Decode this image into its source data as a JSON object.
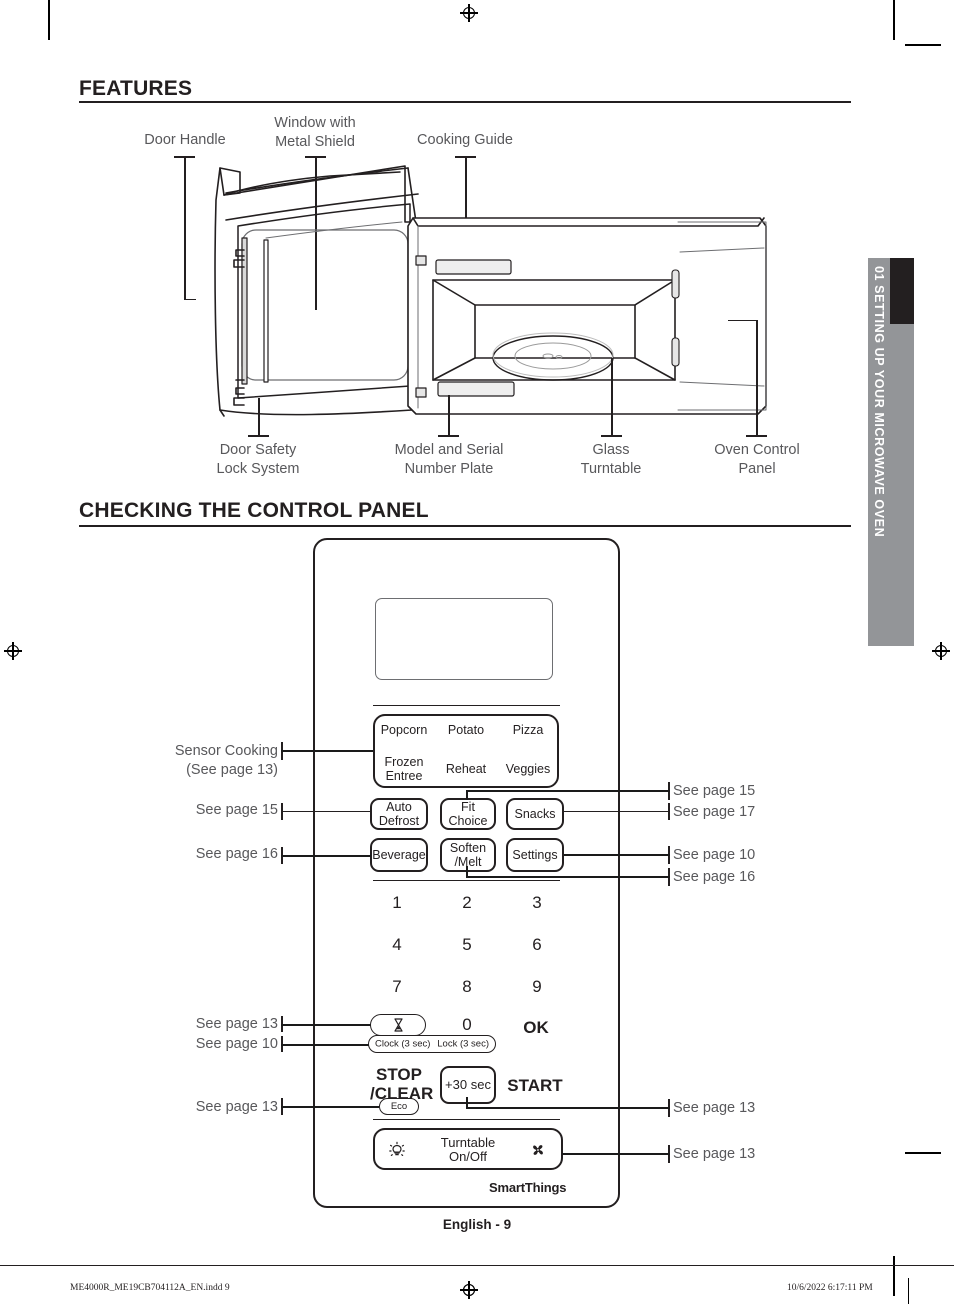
{
  "chapter_tab": {
    "label": "01  SETTING UP YOUR MICROWAVE OVEN"
  },
  "sections": {
    "features": {
      "heading": "FEATURES"
    },
    "control_panel": {
      "heading": "CHECKING THE CONTROL PANEL"
    }
  },
  "diagram": {
    "callouts_top": [
      {
        "id": "door-handle",
        "text": "Door Handle"
      },
      {
        "id": "window-metal-shield",
        "text": "Window with\nMetal Shield"
      },
      {
        "id": "cooking-guide",
        "text": "Cooking Guide"
      }
    ],
    "callouts_bottom": [
      {
        "id": "door-safety-lock-system",
        "text": "Door Safety\nLock System"
      },
      {
        "id": "model-serial-number-plate",
        "text": "Model and Serial\nNumber Plate"
      },
      {
        "id": "glass-turntable",
        "text": "Glass\nTurntable"
      },
      {
        "id": "oven-control-panel",
        "text": "Oven Control\nPanel"
      }
    ]
  },
  "control_panel": {
    "sensor_keys": [
      "Popcorn",
      "Potato",
      "Pizza",
      "Frozen\nEntree",
      "Reheat",
      "Veggies"
    ],
    "buttons": [
      {
        "id": "auto-defrost",
        "label": "Auto\nDefrost"
      },
      {
        "id": "fit-choice",
        "label": "Fit\nChoice"
      },
      {
        "id": "snacks",
        "label": "Snacks"
      },
      {
        "id": "beverage",
        "label": "Beverage"
      },
      {
        "id": "soften-melt",
        "label": "Soften\n/Melt"
      },
      {
        "id": "settings",
        "label": "Settings"
      }
    ],
    "numpad": [
      "1",
      "2",
      "3",
      "4",
      "5",
      "6",
      "7",
      "8",
      "9"
    ],
    "zero_key": "0",
    "ok_key": "OK",
    "timer_pill": {
      "clock_label": "Clock (3 sec)",
      "lock_label": "Lock (3 sec)"
    },
    "stop_clear": "STOP\n/CLEAR",
    "eco_label": "Eco",
    "plus_30": "+30 sec",
    "start": "START",
    "turntable": "Turntable\nOn/Off",
    "brand": "SmartThings",
    "icons": {
      "timer": "hourglass-icon",
      "light": "light-bulb-icon",
      "fan": "fan-icon"
    }
  },
  "annotations": {
    "left": [
      {
        "id": "sensor-cooking",
        "text": "Sensor Cooking\n(See page 13)"
      },
      {
        "id": "see-page-15-left",
        "text": "See page 15"
      },
      {
        "id": "see-page-16-left",
        "text": "See page 16"
      },
      {
        "id": "see-page-13-timer",
        "text": "See page 13"
      },
      {
        "id": "see-page-10-left",
        "text": "See page 10"
      },
      {
        "id": "see-page-13-eco",
        "text": "See page 13"
      }
    ],
    "right": [
      {
        "id": "see-page-15-right",
        "text": "See page 15"
      },
      {
        "id": "see-page-17-right",
        "text": "See page 17"
      },
      {
        "id": "see-page-10-right",
        "text": "See page 10"
      },
      {
        "id": "see-page-16-right",
        "text": "See page 16"
      },
      {
        "id": "see-page-13-start",
        "text": "See page 13"
      },
      {
        "id": "see-page-13-turntable",
        "text": "See page 13"
      }
    ]
  },
  "footer": {
    "page_label": "English - 9",
    "file_name": "ME4000R_ME19CB704112A_EN.indd   9",
    "timestamp": "10/6/2022   6:17:11 PM"
  }
}
